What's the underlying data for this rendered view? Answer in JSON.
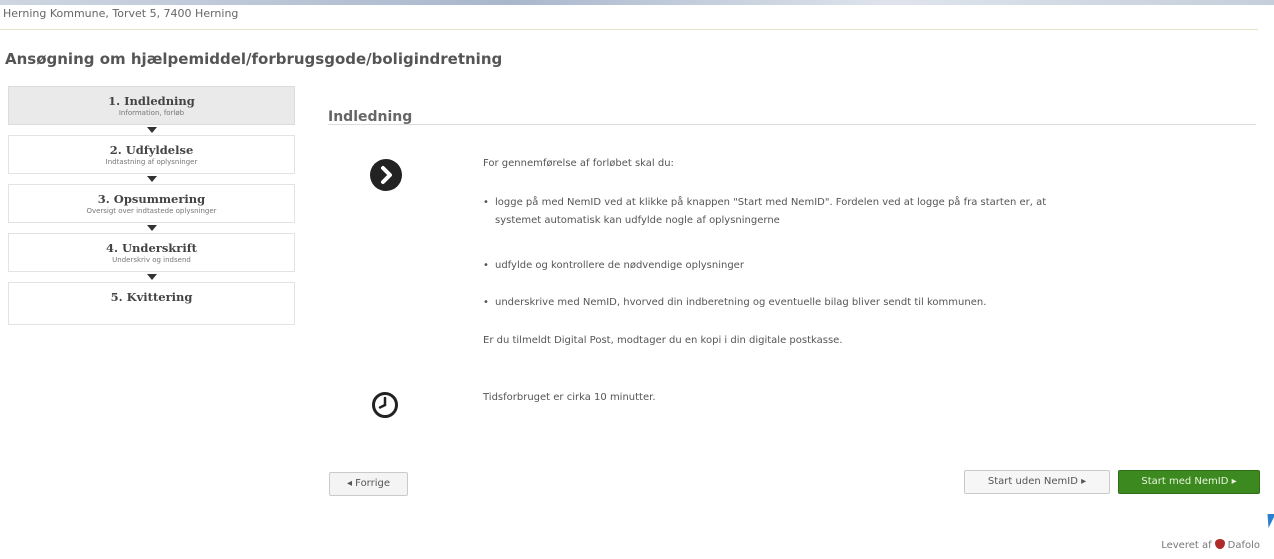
{
  "header": {
    "address": "Herning Kommune, Torvet 5, 7400 Herning"
  },
  "page_title": "Ansøgning om hjælpemiddel/forbrugsgode/boligindretning",
  "steps": [
    {
      "title": "1. Indledning",
      "sub": "Information, forløb",
      "active": true
    },
    {
      "title": "2. Udfyldelse",
      "sub": "Indtastning af oplysninger",
      "active": false
    },
    {
      "title": "3. Opsummering",
      "sub": "Oversigt over indtastede oplysninger",
      "active": false
    },
    {
      "title": "4. Underskrift",
      "sub": "Underskriv og indsend",
      "active": false
    },
    {
      "title": "5. Kvittering",
      "sub": "",
      "active": false
    }
  ],
  "section": {
    "title": "Indledning",
    "intro": "For gennemførelse af forløbet skal du:",
    "bullets": [
      "logge på med NemID ved at klikke på knappen \"Start med NemID\". Fordelen ved at logge på fra starten er, at",
      "systemet automatisk kan udfylde nogle af oplysningerne",
      "udfylde og kontrollere de nødvendige oplysninger",
      "underskrive med NemID, hvorved din indberetning og eventuelle bilag bliver sendt til kommunen."
    ],
    "digital_post": "Er du tilmeldt Digital Post, modtager du en kopi i din digitale postkasse.",
    "time_note": "Tidsforbruget er cirka 10 minutter."
  },
  "buttons": {
    "back": "◂ Forrige",
    "start_without": "Start uden NemID ▸",
    "start_with": "Start med NemID ▸"
  },
  "footer": {
    "delivered_by": "Leveret af",
    "brand": "Dafolo"
  },
  "icons": {
    "step_arrow": "chevron-right-circle-icon",
    "time": "clock-icon",
    "brand_logo": "dafolo-logo-icon"
  },
  "colors": {
    "primary_button": "#3c8a1f",
    "active_step_bg": "#eaeaea"
  }
}
